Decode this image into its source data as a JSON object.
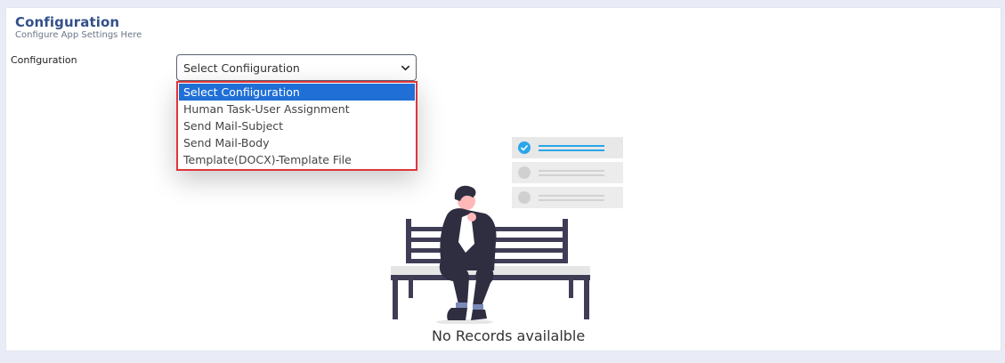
{
  "header": {
    "title": "Configuration",
    "subtitle": "Configure App Settings Here"
  },
  "form": {
    "label": "Configuration",
    "select_value": "Select Confiiguration",
    "options": [
      "Select Confiiguration",
      "Human Task-User Assignment",
      "Send Mail-Subject",
      "Send Mail-Body",
      "Template(DOCX)-Template File"
    ],
    "selected_index": 0
  },
  "empty_state": {
    "message": "No Records availalble",
    "illustration": "person-on-bench-checklist"
  },
  "icons": {
    "select_arrow": "chevron-down-icon",
    "check": "check-circle-icon"
  },
  "colors": {
    "title": "#34508a",
    "selected_option": "#1f6fd6",
    "dropdown_highlight": "#e0353a",
    "background": "#e9ecf6",
    "checklist_accent": "#2aa6e8"
  }
}
